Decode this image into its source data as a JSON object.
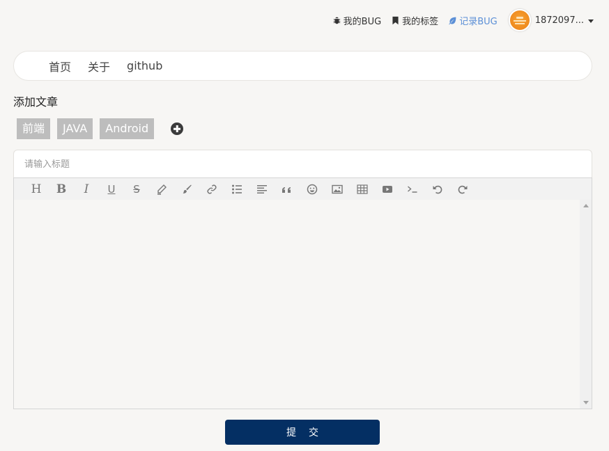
{
  "topbar": {
    "my_bug": "我的BUG",
    "my_tags": "我的标签",
    "record_bug": "记录BUG",
    "username": "1872097...",
    "active_color": "#5b8fd6"
  },
  "nav": {
    "items": [
      "首页",
      "关于",
      "github"
    ]
  },
  "page": {
    "section_title": "添加文章"
  },
  "tags": [
    "前端",
    "JAVA",
    "Android"
  ],
  "editor": {
    "title_placeholder": "请输入标题",
    "toolbar": [
      "heading-icon",
      "bold-icon",
      "italic-icon",
      "underline-icon",
      "strikethrough-icon",
      "pen-icon",
      "brush-icon",
      "link-icon",
      "bullet-list-icon",
      "align-left-icon",
      "quote-icon",
      "emoji-icon",
      "image-icon",
      "table-icon",
      "video-icon",
      "code-icon",
      "undo-icon",
      "redo-icon"
    ]
  },
  "submit_label": "提交",
  "colors": {
    "submit_bg": "#042f63",
    "tag_bg": "#bdbdbd"
  }
}
